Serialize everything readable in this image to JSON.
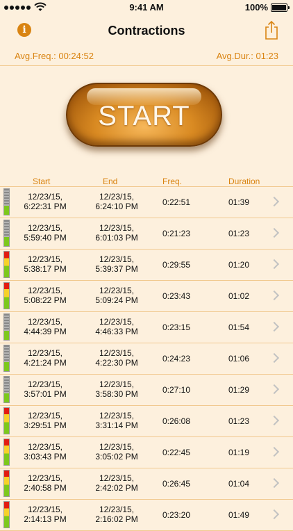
{
  "status_bar": {
    "time": "9:41 AM",
    "battery": "100%"
  },
  "nav": {
    "title": "Contractions",
    "info_icon": "info-icon",
    "share_icon": "share-icon"
  },
  "summary": {
    "avg_freq": "Avg.Freq.: 00:24:52",
    "avg_dur": "Avg.Dur.: 01:23"
  },
  "start_button": {
    "label": "START"
  },
  "table": {
    "headers": {
      "start": "Start",
      "end": "End",
      "freq": "Freq.",
      "duration": "Duration"
    },
    "rows": [
      {
        "meter": "gray",
        "start_date": "12/23/15,",
        "start_time": "6:22:31 PM",
        "end_date": "12/23/15,",
        "end_time": "6:24:10 PM",
        "freq": "0:22:51",
        "duration": "01:39"
      },
      {
        "meter": "gray",
        "start_date": "12/23/15,",
        "start_time": "5:59:40 PM",
        "end_date": "12/23/15,",
        "end_time": "6:01:03 PM",
        "freq": "0:21:23",
        "duration": "01:23"
      },
      {
        "meter": "color",
        "start_date": "12/23/15,",
        "start_time": "5:38:17 PM",
        "end_date": "12/23/15,",
        "end_time": "5:39:37 PM",
        "freq": "0:29:55",
        "duration": "01:20"
      },
      {
        "meter": "color",
        "start_date": "12/23/15,",
        "start_time": "5:08:22 PM",
        "end_date": "12/23/15,",
        "end_time": "5:09:24 PM",
        "freq": "0:23:43",
        "duration": "01:02"
      },
      {
        "meter": "gray",
        "start_date": "12/23/15,",
        "start_time": "4:44:39 PM",
        "end_date": "12/23/15,",
        "end_time": "4:46:33 PM",
        "freq": "0:23:15",
        "duration": "01:54"
      },
      {
        "meter": "gray",
        "start_date": "12/23/15,",
        "start_time": "4:21:24 PM",
        "end_date": "12/23/15,",
        "end_time": "4:22:30 PM",
        "freq": "0:24:23",
        "duration": "01:06"
      },
      {
        "meter": "gray",
        "start_date": "12/23/15,",
        "start_time": "3:57:01 PM",
        "end_date": "12/23/15,",
        "end_time": "3:58:30 PM",
        "freq": "0:27:10",
        "duration": "01:29"
      },
      {
        "meter": "color",
        "start_date": "12/23/15,",
        "start_time": "3:29:51 PM",
        "end_date": "12/23/15,",
        "end_time": "3:31:14 PM",
        "freq": "0:26:08",
        "duration": "01:23"
      },
      {
        "meter": "color",
        "start_date": "12/23/15,",
        "start_time": "3:03:43 PM",
        "end_date": "12/23/15,",
        "end_time": "3:05:02 PM",
        "freq": "0:22:45",
        "duration": "01:19"
      },
      {
        "meter": "color",
        "start_date": "12/23/15,",
        "start_time": "2:40:58 PM",
        "end_date": "12/23/15,",
        "end_time": "2:42:02 PM",
        "freq": "0:26:45",
        "duration": "01:04"
      },
      {
        "meter": "color",
        "start_date": "12/23/15,",
        "start_time": "2:14:13 PM",
        "end_date": "12/23/15,",
        "end_time": "2:16:02 PM",
        "freq": "0:23:20",
        "duration": "01:49"
      }
    ]
  },
  "colors": {
    "accent": "#d98412",
    "background": "#fdf0dd",
    "divider": "#f1c98f"
  }
}
